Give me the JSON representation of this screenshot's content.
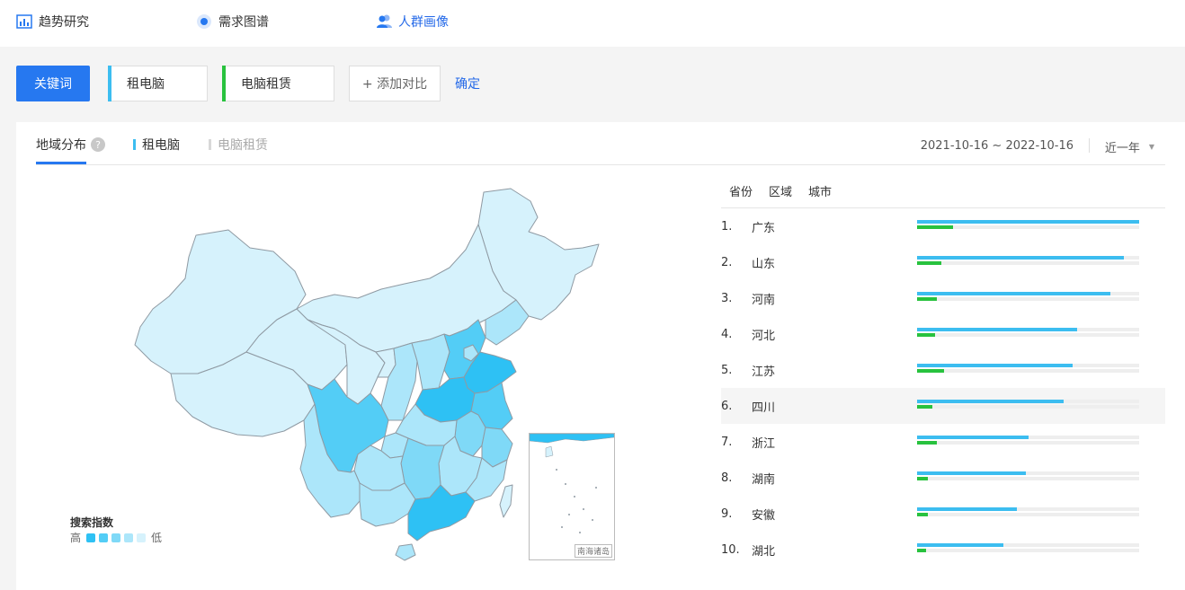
{
  "nav": {
    "items": [
      {
        "label": "趋势研究",
        "icon": "chart-box-icon"
      },
      {
        "label": "需求图谱",
        "icon": "radar-icon"
      },
      {
        "label": "人群画像",
        "icon": "users-icon"
      }
    ]
  },
  "keywords": {
    "button_label": "关键词",
    "items": [
      {
        "label": "租电脑",
        "color": "#3cbdf0"
      },
      {
        "label": "电脑租赁",
        "color": "#28c23e"
      }
    ],
    "add_label": "+ 添加对比",
    "confirm_label": "确定"
  },
  "panel": {
    "tab_title": "地域分布",
    "help": "?",
    "legend": [
      {
        "label": "租电脑",
        "color": "#3cbdf0",
        "active": true
      },
      {
        "label": "电脑租赁",
        "color": "#d8d8d8",
        "active": false
      }
    ],
    "date_range": "2021-10-16 ~ 2022-10-16",
    "period": "近一年"
  },
  "map": {
    "legend_title": "搜索指数",
    "high": "高",
    "low": "低",
    "scale_colors": [
      "#2ec1f4",
      "#53cdf6",
      "#7fd9f7",
      "#ace6fa",
      "#d6f2fc"
    ],
    "inset_label": "南海诸岛"
  },
  "ranking": {
    "tabs": [
      "省份",
      "区域",
      "城市"
    ],
    "rows": [
      {
        "idx": "1.",
        "name": "广东",
        "a": 1.0,
        "b": 0.16
      },
      {
        "idx": "2.",
        "name": "山东",
        "a": 0.93,
        "b": 0.11
      },
      {
        "idx": "3.",
        "name": "河南",
        "a": 0.87,
        "b": 0.09
      },
      {
        "idx": "4.",
        "name": "河北",
        "a": 0.72,
        "b": 0.08
      },
      {
        "idx": "5.",
        "name": "江苏",
        "a": 0.7,
        "b": 0.12
      },
      {
        "idx": "6.",
        "name": "四川",
        "a": 0.66,
        "b": 0.07
      },
      {
        "idx": "7.",
        "name": "浙江",
        "a": 0.5,
        "b": 0.09
      },
      {
        "idx": "8.",
        "name": "湖南",
        "a": 0.49,
        "b": 0.05
      },
      {
        "idx": "9.",
        "name": "安徽",
        "a": 0.45,
        "b": 0.05
      },
      {
        "idx": "10.",
        "name": "湖北",
        "a": 0.39,
        "b": 0.04
      }
    ]
  }
}
